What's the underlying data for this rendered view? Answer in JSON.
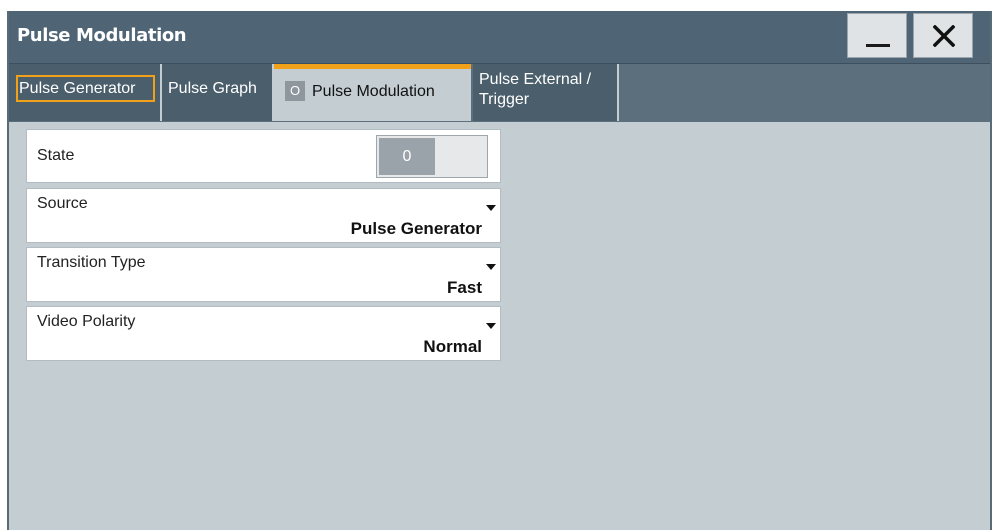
{
  "window": {
    "title": "Pulse Modulation",
    "minimize_icon": "minimize-icon",
    "close_icon": "close-icon"
  },
  "tabs": [
    {
      "label": "Pulse Generator",
      "focused": true
    },
    {
      "label": "Pulse Graph"
    },
    {
      "label": "Pulse Modulation",
      "indicator": "O",
      "active": true
    },
    {
      "label": "Pulse External /\nTrigger"
    }
  ],
  "settings": {
    "state": {
      "label": "State",
      "value": "0"
    },
    "source": {
      "label": "Source",
      "value": "Pulse Generator"
    },
    "transition_type": {
      "label": "Transition Type",
      "value": "Fast"
    },
    "video_polarity": {
      "label": "Video Polarity",
      "value": "Normal"
    }
  },
  "colors": {
    "accent": "#f0a019",
    "titlebar": "#4f6575",
    "background": "#c3cdd2"
  }
}
